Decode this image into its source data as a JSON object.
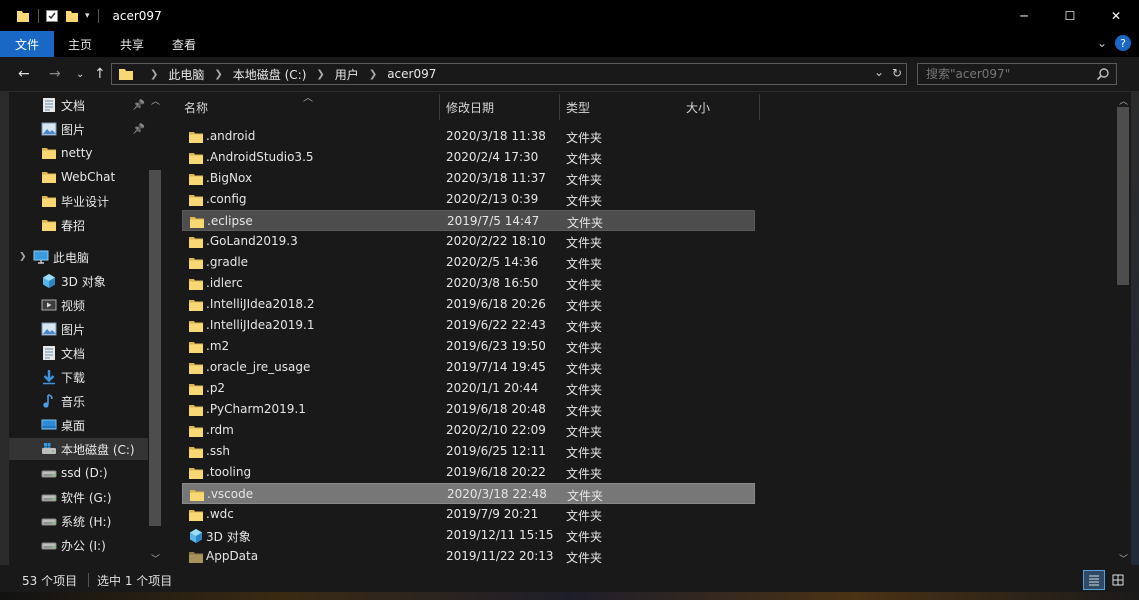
{
  "window": {
    "title": "acer097",
    "minimize": "─",
    "maximize": "☐",
    "close": "✕"
  },
  "ribbon": {
    "tabs": [
      {
        "label": "文件",
        "active": true
      },
      {
        "label": "主页",
        "active": false
      },
      {
        "label": "共享",
        "active": false
      },
      {
        "label": "查看",
        "active": false
      }
    ],
    "expand": "⌄",
    "help": "?"
  },
  "address": {
    "crumbs": [
      "此电脑",
      "本地磁盘 (C:)",
      "用户",
      "acer097"
    ],
    "dropdown": "⌄",
    "refresh": "↻"
  },
  "search": {
    "placeholder": "搜索\"acer097\""
  },
  "nav": {
    "items": [
      {
        "label": "文档",
        "icon": "documents-icon",
        "pinned": true
      },
      {
        "label": "图片",
        "icon": "pictures-icon",
        "pinned": true
      },
      {
        "label": "netty",
        "icon": "folder-icon"
      },
      {
        "label": "WebChat",
        "icon": "folder-icon"
      },
      {
        "label": "毕业设计",
        "icon": "folder-icon"
      },
      {
        "label": "春招",
        "icon": "folder-icon"
      },
      {
        "label": "此电脑",
        "icon": "this-pc-icon",
        "expander": true
      },
      {
        "label": "3D 对象",
        "icon": "3d-objects-icon"
      },
      {
        "label": "视频",
        "icon": "videos-icon"
      },
      {
        "label": "图片",
        "icon": "pictures-icon"
      },
      {
        "label": "文档",
        "icon": "documents-icon"
      },
      {
        "label": "下载",
        "icon": "downloads-icon"
      },
      {
        "label": "音乐",
        "icon": "music-icon"
      },
      {
        "label": "桌面",
        "icon": "desktop-icon"
      },
      {
        "label": "本地磁盘 (C:)",
        "icon": "windows-drive-icon",
        "selected": true
      },
      {
        "label": "ssd (D:)",
        "icon": "drive-icon"
      },
      {
        "label": "软件 (G:)",
        "icon": "drive-icon"
      },
      {
        "label": "系统 (H:)",
        "icon": "drive-icon"
      },
      {
        "label": "办公 (I:)",
        "icon": "drive-icon"
      }
    ]
  },
  "columns": {
    "name": "名称",
    "date": "修改日期",
    "type": "类型",
    "size": "大小"
  },
  "files": [
    {
      "name": ".android",
      "date": "2020/3/18 11:38",
      "type": "文件夹",
      "icon": "folder-icon"
    },
    {
      "name": ".AndroidStudio3.5",
      "date": "2020/2/4 17:30",
      "type": "文件夹",
      "icon": "folder-icon"
    },
    {
      "name": ".BigNox",
      "date": "2020/3/18 11:37",
      "type": "文件夹",
      "icon": "folder-icon"
    },
    {
      "name": ".config",
      "date": "2020/2/13 0:39",
      "type": "文件夹",
      "icon": "folder-icon"
    },
    {
      "name": ".eclipse",
      "date": "2019/7/5 14:47",
      "type": "文件夹",
      "icon": "folder-icon",
      "state": "hover"
    },
    {
      "name": ".GoLand2019.3",
      "date": "2020/2/22 18:10",
      "type": "文件夹",
      "icon": "folder-icon"
    },
    {
      "name": ".gradle",
      "date": "2020/2/5 14:36",
      "type": "文件夹",
      "icon": "folder-icon"
    },
    {
      "name": ".idlerc",
      "date": "2020/3/8 16:50",
      "type": "文件夹",
      "icon": "folder-icon"
    },
    {
      "name": ".IntelliJIdea2018.2",
      "date": "2019/6/18 20:26",
      "type": "文件夹",
      "icon": "folder-icon"
    },
    {
      "name": ".IntelliJIdea2019.1",
      "date": "2019/6/22 22:43",
      "type": "文件夹",
      "icon": "folder-icon"
    },
    {
      "name": ".m2",
      "date": "2019/6/23 19:50",
      "type": "文件夹",
      "icon": "folder-icon"
    },
    {
      "name": ".oracle_jre_usage",
      "date": "2019/7/14 19:45",
      "type": "文件夹",
      "icon": "folder-icon"
    },
    {
      "name": ".p2",
      "date": "2020/1/1 20:44",
      "type": "文件夹",
      "icon": "folder-icon"
    },
    {
      "name": ".PyCharm2019.1",
      "date": "2019/6/18 20:48",
      "type": "文件夹",
      "icon": "folder-icon"
    },
    {
      "name": ".rdm",
      "date": "2020/2/10 22:09",
      "type": "文件夹",
      "icon": "folder-icon"
    },
    {
      "name": ".ssh",
      "date": "2019/6/25 12:11",
      "type": "文件夹",
      "icon": "folder-icon"
    },
    {
      "name": ".tooling",
      "date": "2019/6/18 20:22",
      "type": "文件夹",
      "icon": "folder-icon"
    },
    {
      "name": ".vscode",
      "date": "2020/3/18 22:48",
      "type": "文件夹",
      "icon": "folder-icon",
      "state": "selected"
    },
    {
      "name": ".wdc",
      "date": "2019/7/9 20:21",
      "type": "文件夹",
      "icon": "folder-icon"
    },
    {
      "name": "3D 对象",
      "date": "2019/12/11 15:15",
      "type": "文件夹",
      "icon": "3d-objects-icon"
    },
    {
      "name": "AppData",
      "date": "2019/11/22 20:13",
      "type": "文件夹",
      "icon": "hidden-folder-icon"
    }
  ],
  "status": {
    "count": "53 个项目",
    "selection": "选中 1 个项目"
  },
  "colors": {
    "accent": "#1a68c6",
    "folder": "#f8d775",
    "background": "#191919"
  }
}
